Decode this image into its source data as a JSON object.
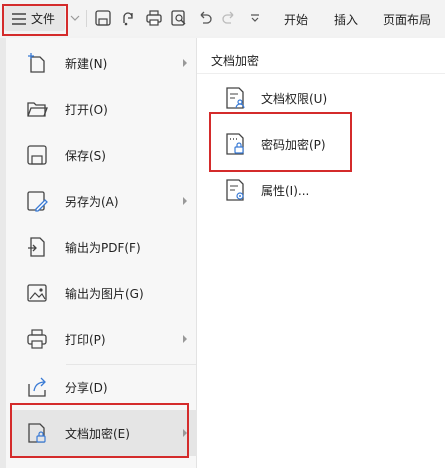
{
  "toolbar": {
    "file_label": "文件",
    "tabs": [
      "开始",
      "插入",
      "页面布局"
    ],
    "icons": [
      "menu-icon",
      "chevron-down-icon",
      "save-icon",
      "export-icon",
      "print-icon",
      "preview-icon",
      "undo-icon",
      "redo-icon",
      "customize-icon"
    ]
  },
  "file_menu": {
    "items": [
      {
        "label": "新建(N)",
        "icon": "new-file-icon",
        "submenu": true
      },
      {
        "label": "打开(O)",
        "icon": "folder-open-icon",
        "submenu": false
      },
      {
        "label": "保存(S)",
        "icon": "save-icon",
        "submenu": false
      },
      {
        "label": "另存为(A)",
        "icon": "save-as-icon",
        "submenu": true
      },
      {
        "label": "输出为PDF(F)",
        "icon": "export-pdf-icon",
        "submenu": false
      },
      {
        "label": "输出为图片(G)",
        "icon": "export-image-icon",
        "submenu": false
      },
      {
        "label": "打印(P)",
        "icon": "print-icon",
        "submenu": true
      },
      {
        "label": "分享(D)",
        "icon": "share-icon",
        "submenu": false
      },
      {
        "label": "文档加密(E)",
        "icon": "document-encrypt-icon",
        "submenu": true,
        "active": true
      }
    ]
  },
  "submenu": {
    "title": "文档加密",
    "items": [
      {
        "label": "文档权限(U)",
        "icon": "document-permission-icon"
      },
      {
        "label": "密码加密(P)",
        "icon": "password-encrypt-icon"
      },
      {
        "label": "属性(I)...",
        "icon": "document-properties-icon"
      }
    ]
  },
  "colors": {
    "highlight_border": "#d42b2b",
    "accent_blue": "#3a7bd5",
    "icon_gray": "#4a4a4a"
  }
}
